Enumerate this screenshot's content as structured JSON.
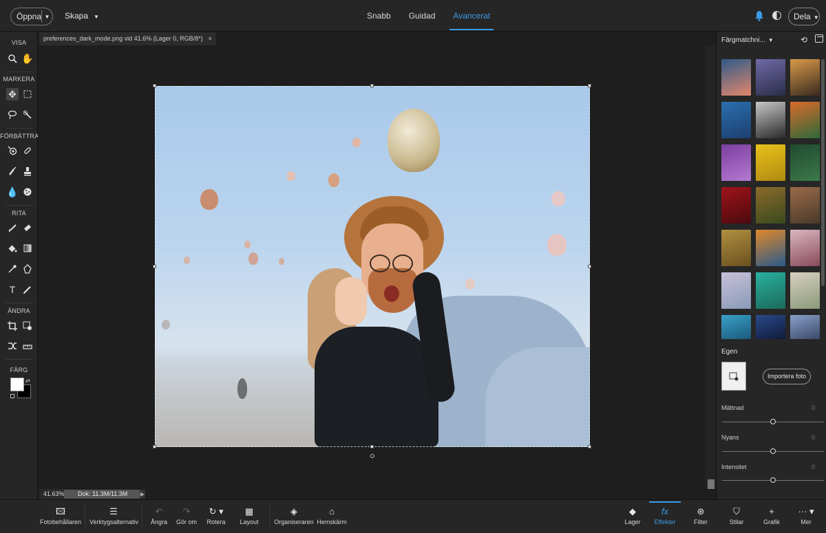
{
  "topbar": {
    "open_label": "Öppna",
    "create_label": "Skapa",
    "share_label": "Dela",
    "tabs": [
      {
        "label": "Snabb"
      },
      {
        "label": "Guidad"
      },
      {
        "label": "Avancerat",
        "active": true
      }
    ]
  },
  "toolbox": {
    "sections": {
      "view": "VISA",
      "select": "MARKERA",
      "enhance": "FÖRBÄTTRA",
      "draw": "RITA",
      "modify": "ÄNDRA",
      "color": "FÄRG"
    },
    "foreground_color": "#ffffff",
    "background_color": "#000000"
  },
  "document": {
    "tab_title": "preferences_dark_mode.png vid 41.6% (Lager 0, RGB/8*)",
    "close_glyph": "×"
  },
  "status": {
    "zoom": "41.63%",
    "doc_info": "Dok: 11.3M/11.3M"
  },
  "right_panel": {
    "title": "Färgmatchni...",
    "own_label": "Egen",
    "import_label": "Importera foto",
    "sliders": [
      {
        "label": "Mättnad",
        "value": "0",
        "position": 0.5
      },
      {
        "label": "Nyans",
        "value": "0",
        "position": 0.5
      },
      {
        "label": "Intensitet",
        "value": "0",
        "position": 0.5
      }
    ],
    "presets": [
      {
        "c1": "#2f5a8a",
        "c2": "#e3876b"
      },
      {
        "c1": "#6f6aa6",
        "c2": "#2c2d4a"
      },
      {
        "c1": "#d89a4a",
        "c2": "#3a2a1e"
      },
      {
        "c1": "#2a6fb0",
        "c2": "#1d3f6e"
      },
      {
        "c1": "#c7c7c7",
        "c2": "#2a2a2a"
      },
      {
        "c1": "#d96a2a",
        "c2": "#2f6a3a"
      },
      {
        "c1": "#7a3fa0",
        "c2": "#b47ad0"
      },
      {
        "c1": "#e8c21a",
        "c2": "#b08a10"
      },
      {
        "c1": "#1f4a2e",
        "c2": "#3c7a4a"
      },
      {
        "c1": "#a0141a",
        "c2": "#4a0a0e"
      },
      {
        "c1": "#8a6a2a",
        "c2": "#3a4a1e"
      },
      {
        "c1": "#9a6a4a",
        "c2": "#4a3a2a"
      },
      {
        "c1": "#b09040",
        "c2": "#6a5020"
      },
      {
        "c1": "#e0882a",
        "c2": "#2a5a8a"
      },
      {
        "c1": "#d9b7c0",
        "c2": "#8a4a5a"
      },
      {
        "c1": "#c8c0d8",
        "c2": "#8a9ab8"
      },
      {
        "c1": "#2ab0a0",
        "c2": "#1a6a5a"
      },
      {
        "c1": "#d8d0c0",
        "c2": "#8a9a7a"
      },
      {
        "c1": "#3aa0c8",
        "c2": "#1a5a7a"
      },
      {
        "c1": "#2a4a8a",
        "c2": "#0f1a3a"
      },
      {
        "c1": "#8aa0c8",
        "c2": "#3a4a6a"
      }
    ]
  },
  "bottombar": {
    "items": [
      {
        "label": "Fotobehållaren",
        "icon": "photo-bin-icon"
      },
      {
        "label": "Verktygsalternativ",
        "icon": "tool-options-icon"
      },
      {
        "label": "Ångra",
        "icon": "undo-icon"
      },
      {
        "label": "Gör om",
        "icon": "redo-icon"
      },
      {
        "label": "Rotera",
        "icon": "rotate-icon"
      },
      {
        "label": "Layout",
        "icon": "layout-icon"
      },
      {
        "label": "Organiseraren",
        "icon": "organizer-icon"
      },
      {
        "label": "Hemskärm",
        "icon": "home-icon"
      },
      {
        "label": "Lager",
        "icon": "layers-icon"
      },
      {
        "label": "Effekter",
        "icon": "fx-icon"
      },
      {
        "label": "Filter",
        "icon": "filter-icon"
      },
      {
        "label": "Stilar",
        "icon": "styles-icon"
      },
      {
        "label": "Grafik",
        "icon": "graphics-icon"
      },
      {
        "label": "Mer",
        "icon": "more-icon"
      }
    ]
  },
  "colors": {
    "accent": "#3c9ce8"
  }
}
